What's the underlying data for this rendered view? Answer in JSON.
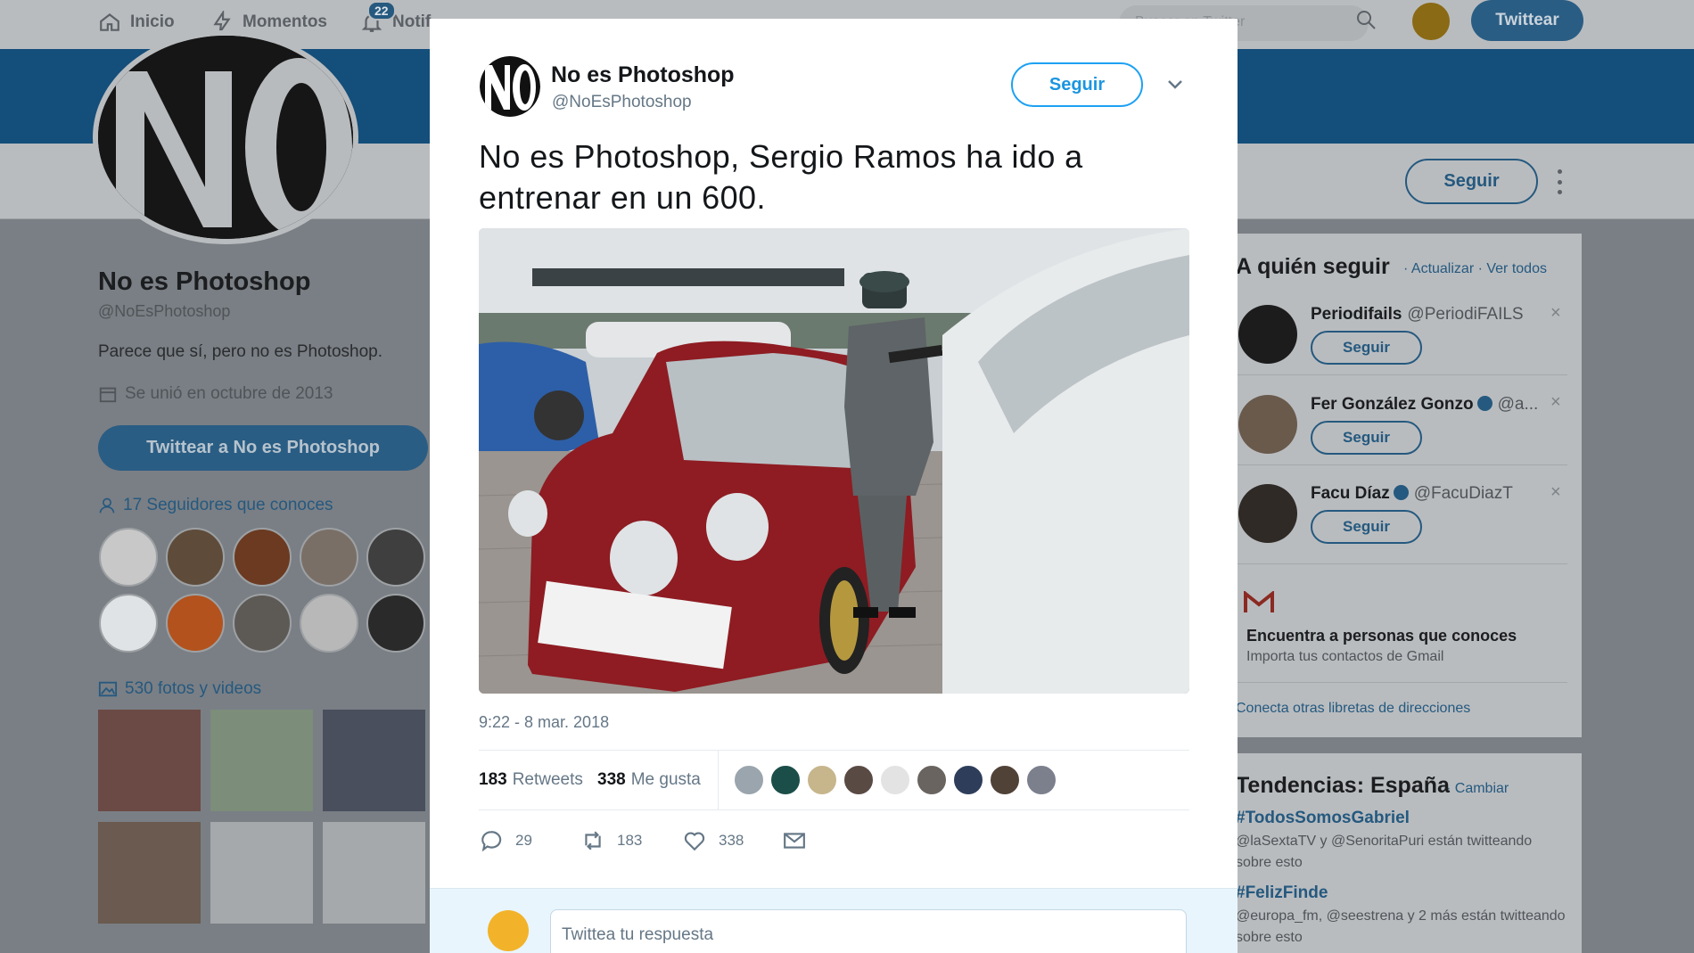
{
  "topnav": {
    "home": "Inicio",
    "moments": "Momentos",
    "notifications": "Notif",
    "notif_count": "22",
    "search_placeholder": "Buscar en Twitter",
    "tweet_button": "Twittear"
  },
  "profile": {
    "name": "No es Photoshop",
    "handle": "@NoEsPhotoshop",
    "bio": "Parece que sí, pero no es Photoshop.",
    "joined": "Se unió en octubre de 2013",
    "tweet_to": "Twittear a No es Photoshop",
    "followers_you_know": "17 Seguidores que conoces",
    "photos_videos": "530 fotos y videos",
    "follow_button": "Seguir"
  },
  "who_to_follow": {
    "title": "A quién seguir",
    "links": "· Actualizar · Ver todos",
    "suggestions": [
      {
        "name": "Periodifails",
        "handle": "@PeriodiFAILS",
        "button": "Seguir",
        "verified": false
      },
      {
        "name": "Fer González Gonzo",
        "handle": "@a...",
        "button": "Seguir",
        "verified": true
      },
      {
        "name": "Facu Díaz",
        "handle": "@FacuDiazT",
        "button": "Seguir",
        "verified": true
      }
    ],
    "close": "×",
    "gmail_title": "Encuentra a personas que conoces",
    "gmail_sub": "Importa tus contactos de Gmail",
    "other_books": "Conecta otras libretas de direcciones"
  },
  "trends": {
    "title": "Tendencias: España",
    "change": "· Cambiar",
    "items": [
      {
        "tag": "#TodosSomosGabriel",
        "desc": "@laSextaTV y @SenoritaPuri están twitteando sobre esto"
      },
      {
        "tag": "#FelizFinde",
        "desc": "@europa_fm, @seestrena y 2 más están twitteando sobre esto"
      }
    ]
  },
  "tweet": {
    "author_name": "No es Photoshop",
    "author_handle": "@NoEsPhotoshop",
    "follow_button": "Seguir",
    "text": "No es Photoshop, Sergio Ramos ha ido a entrenar en un 600.",
    "timestamp": "9:22 - 8 mar. 2018",
    "retweets_count": "183",
    "retweets_label": "Retweets",
    "likes_count": "338",
    "likes_label": "Me gusta",
    "actions": {
      "replies": "29",
      "retweets": "183",
      "likes": "338"
    },
    "reply_placeholder": "Twittea tu respuesta"
  },
  "colors": {
    "twitter_blue": "#1da1f2",
    "link_blue": "#1b95e0",
    "car_red": "#8e1c22"
  }
}
